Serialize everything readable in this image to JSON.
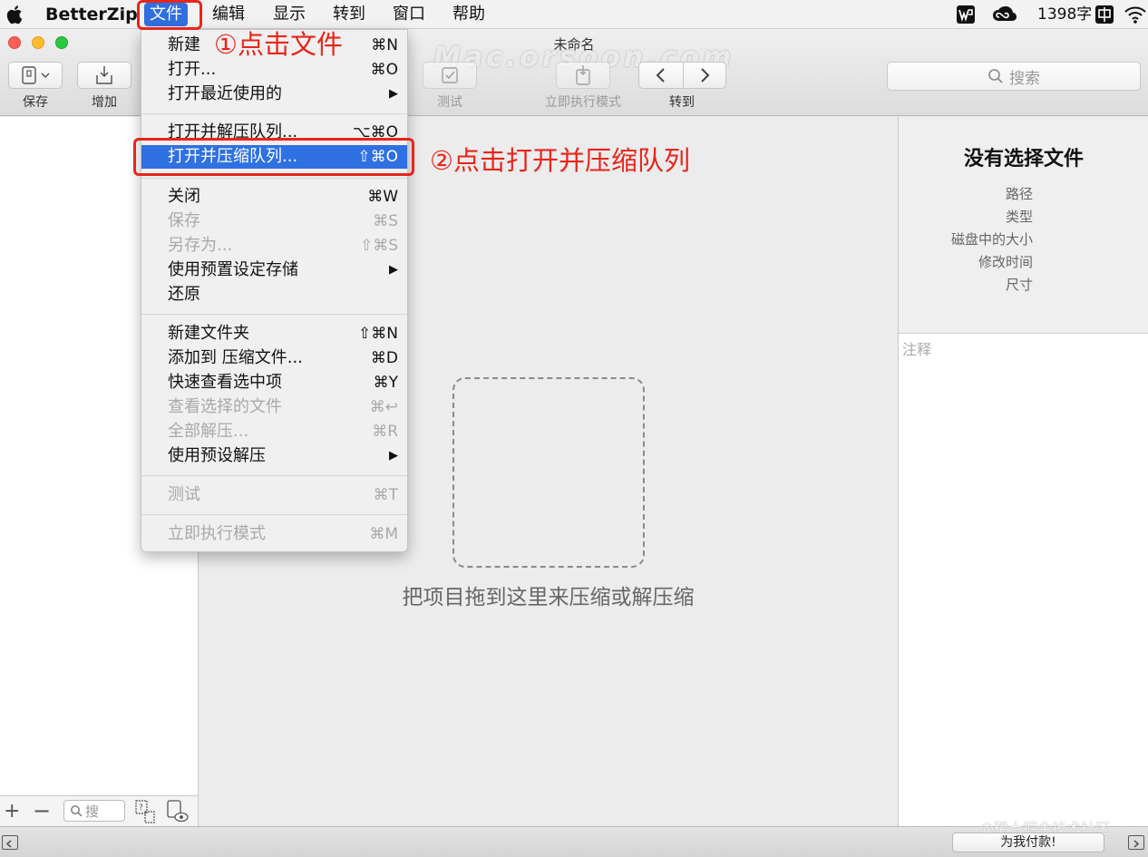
{
  "menubar": {
    "app_name": "BetterZip",
    "items": [
      "文件",
      "编辑",
      "显示",
      "转到",
      "窗口",
      "帮助"
    ],
    "status_text": "1398字"
  },
  "window": {
    "title": "未命名",
    "watermark": "Mac.orsoon.com"
  },
  "toolbar": {
    "save_label": "保存",
    "add_label": "增加",
    "test_label": "测试",
    "instant_mode_label": "立即执行模式",
    "goto_label": "转到",
    "search_placeholder": "搜索"
  },
  "file_menu": {
    "new": {
      "label": "新建",
      "shortcut": "⌘N"
    },
    "open": {
      "label": "打开...",
      "shortcut": "⌘O"
    },
    "open_recent": {
      "label": "打开最近使用的",
      "shortcut": "▶"
    },
    "open_extract_queue": {
      "label": "打开并解压队列...",
      "shortcut": "⌥⌘O"
    },
    "open_compress_queue": {
      "label": "打开并压缩队列...",
      "shortcut": "⇧⌘O"
    },
    "close": {
      "label": "关闭",
      "shortcut": "⌘W"
    },
    "save": {
      "label": "保存",
      "shortcut": "⌘S"
    },
    "save_as": {
      "label": "另存为...",
      "shortcut": "⇧⌘S"
    },
    "save_with_preset": {
      "label": "使用预置设定存储",
      "shortcut": "▶"
    },
    "revert": {
      "label": "还原",
      "shortcut": ""
    },
    "new_folder": {
      "label": "新建文件夹",
      "shortcut": "⇧⌘N"
    },
    "add_to_archive": {
      "label": "添加到 压缩文件...",
      "shortcut": "⌘D"
    },
    "quick_look": {
      "label": "快速查看选中项",
      "shortcut": "⌘Y"
    },
    "view_selected": {
      "label": "查看选择的文件",
      "shortcut": "⌘↩"
    },
    "extract_all": {
      "label": "全部解压...",
      "shortcut": "⌘R"
    },
    "extract_with_preset": {
      "label": "使用预设解压",
      "shortcut": "▶"
    },
    "test": {
      "label": "测试",
      "shortcut": "⌘T"
    },
    "instant_mode": {
      "label": "立即执行模式",
      "shortcut": "⌘M"
    }
  },
  "center": {
    "drop_hint": "把项目拖到这里来压缩或解压缩"
  },
  "info_panel": {
    "title": "没有选择文件",
    "path_label": "路径",
    "type_label": "类型",
    "size_label": "磁盘中的大小",
    "modified_label": "修改时间",
    "dimensions_label": "尺寸",
    "comment_placeholder": "注释"
  },
  "left_bottom": {
    "search_placeholder": "搜"
  },
  "statusbar": {
    "donate_label": "为我付款!",
    "credit": "@稀土掘金技术社区"
  },
  "annotations": {
    "step1": "①点击文件",
    "step2": "②点击打开并压缩队列"
  },
  "colors": {
    "highlight": "#2f70e2",
    "annotation": "#e8251b"
  }
}
